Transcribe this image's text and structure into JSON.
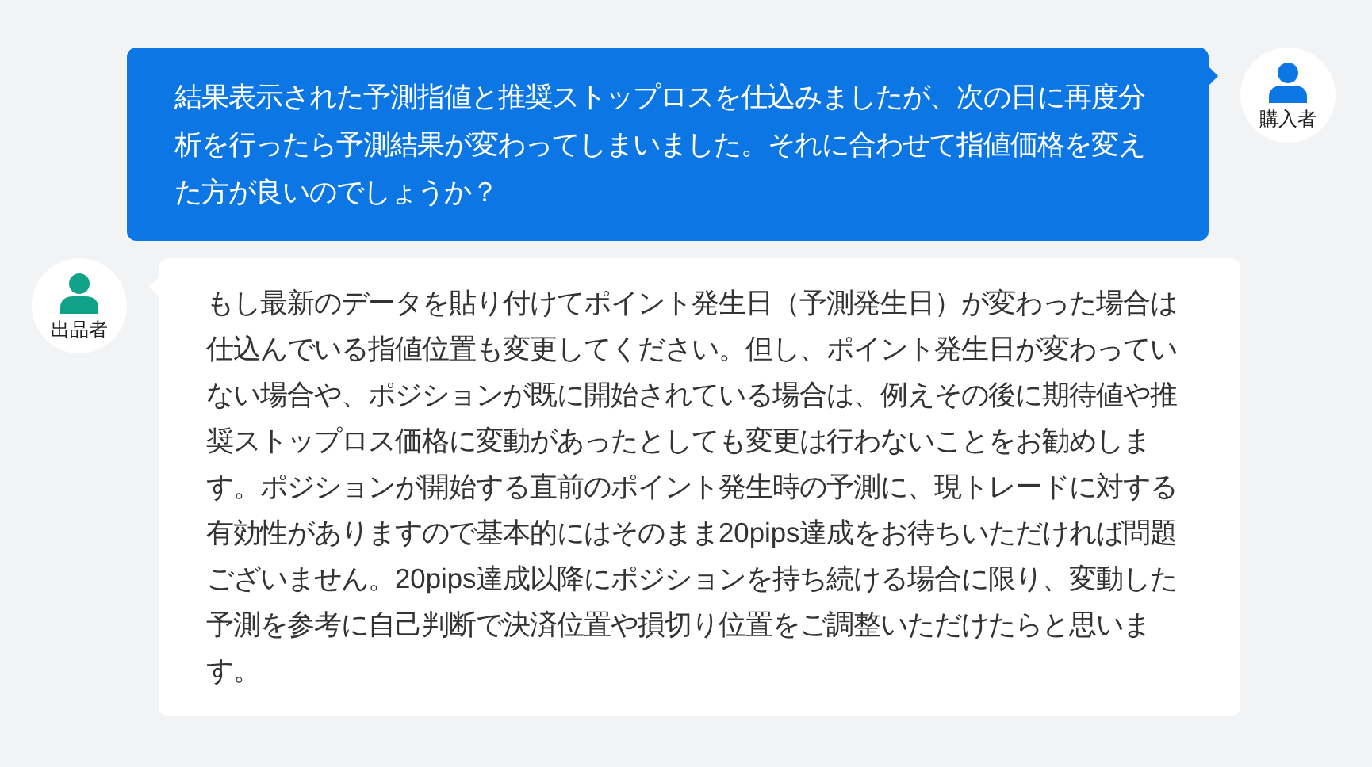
{
  "messages": [
    {
      "kind": "buyer",
      "role": "購入者",
      "text": "結果表示された予測指値と推奨ストップロスを仕込みましたが、次の日に再度分析を行ったら予測結果が変わってしまいました。それに合わせて指値価格を変えた方が良いのでしょうか？"
    },
    {
      "kind": "seller",
      "role": "出品者",
      "text": "もし最新のデータを貼り付けてポイント発生日（予測発生日）が変わった場合は仕込んでいる指値位置も変更してください。但し、ポイント発生日が変わっていない場合や、ポジションが既に開始されている場合は、例えその後に期待値や推奨ストップロス価格に変動があったとしても変更は行わないことをお勧めします。ポジションが開始する直前のポイント発生時の予測に、現トレードに対する有効性がありますので基本的にはそのまま20pips達成をお待ちいただければ問題ございません。20pips達成以降にポジションを持ち続ける場合に限り、変動した予測を参考に自己判断で決済位置や損切り位置をご調整いただけたらと思います。"
    }
  ]
}
